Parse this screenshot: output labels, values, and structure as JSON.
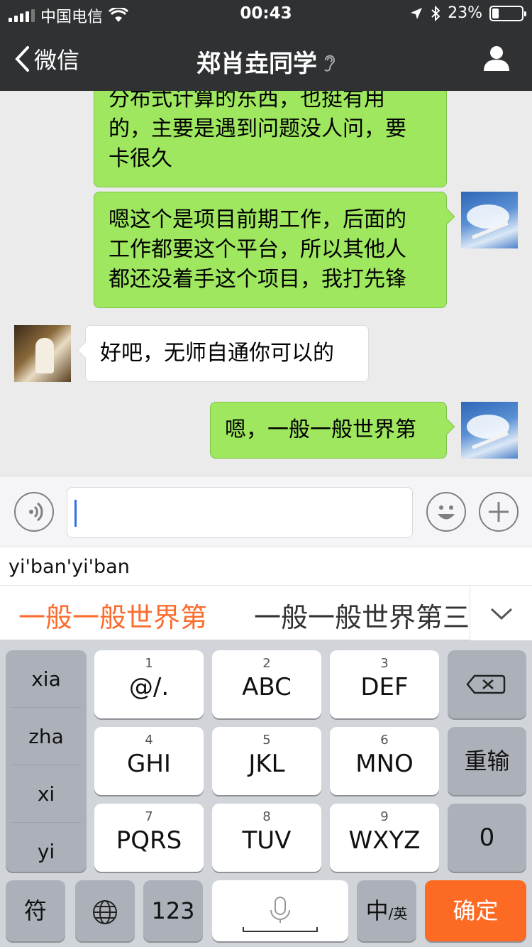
{
  "status_bar": {
    "carrier": "中国电信",
    "time": "00:43",
    "battery": "23%",
    "battery_level": 0.23
  },
  "nav": {
    "back_label": "微信",
    "title": "郑肖垚同学"
  },
  "messages": [
    {
      "from": "me",
      "lines": [
        "分布式计算的东西，也挺有用",
        "的，主要是遇到问题没人问，要",
        "卡很久"
      ]
    },
    {
      "from": "me",
      "lines": [
        "嗯这个是项目前期工作，后面的",
        "工作都要这个平台，所以其他人",
        "都还没着手这个项目，我打先锋"
      ]
    },
    {
      "from": "other",
      "lines": [
        "好吧，无师自通你可以的"
      ]
    },
    {
      "from": "me",
      "lines": [
        "嗯，一般一般世界第"
      ]
    }
  ],
  "input": {
    "value": ""
  },
  "ime": {
    "pinyin": "yi'ban'yi'ban",
    "candidates": [
      "一般一般世界第",
      "一般一般世界第三"
    ],
    "side_options": [
      "xia",
      "zha",
      "xi",
      "yi"
    ],
    "keys": [
      {
        "num": "1",
        "label": "@/."
      },
      {
        "num": "2",
        "label": "ABC"
      },
      {
        "num": "3",
        "label": "DEF"
      },
      {
        "num": "4",
        "label": "GHI"
      },
      {
        "num": "5",
        "label": "JKL"
      },
      {
        "num": "6",
        "label": "MNO"
      },
      {
        "num": "7",
        "label": "PQRS"
      },
      {
        "num": "8",
        "label": "TUV"
      },
      {
        "num": "9",
        "label": "WXYZ"
      }
    ],
    "reinput": "重输",
    "zero": "0",
    "symbol": "符",
    "num_mode": "123",
    "lang_main": "中",
    "lang_sub": "/英",
    "confirm": "确定"
  },
  "colors": {
    "header_bg": "#2f3133",
    "my_bubble": "#9ee75f",
    "accent_candidate": "#fa6d2e",
    "confirm_key": "#fc6a23"
  }
}
